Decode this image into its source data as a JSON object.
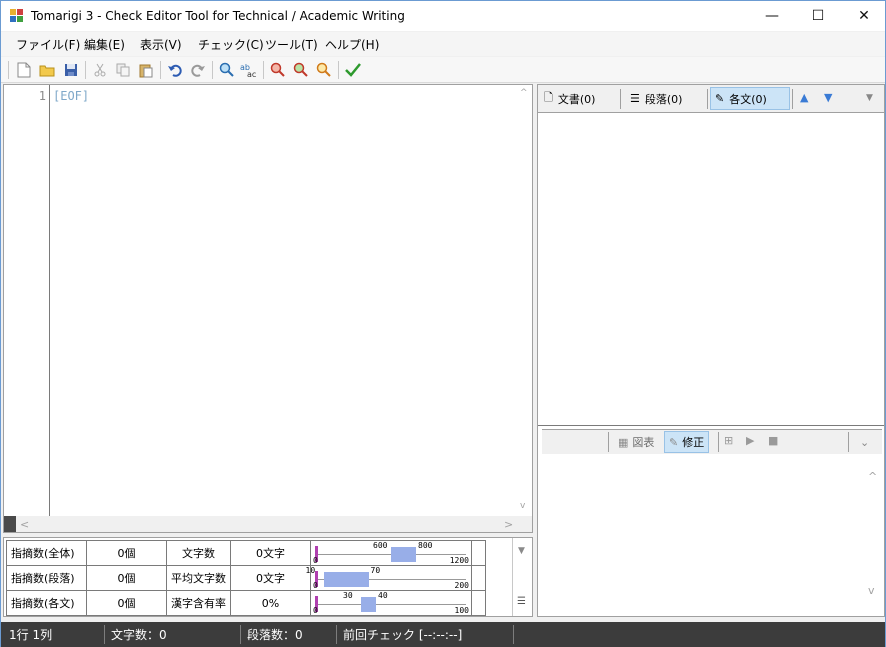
{
  "window": {
    "title": "Tomarigi 3 - Check Editor Tool for Technical / Academic Writing",
    "minimize": "—",
    "maximize": "☐",
    "close": "✕"
  },
  "menu": {
    "file": "ファイル(F)",
    "edit": "編集(E)",
    "view": "表示(V)",
    "check": "チェック(C)",
    "tools": "ツール(T)",
    "help": "ヘルプ(H)"
  },
  "toolbar_icons": [
    "new-file-icon",
    "open-folder-icon",
    "save-icon",
    "cut-icon",
    "copy-icon",
    "paste-icon",
    "undo-icon",
    "redo-icon",
    "find-icon",
    "replace-icon",
    "prev-issue-icon",
    "next-issue-icon",
    "search-zoom-icon",
    "check-icon"
  ],
  "editor": {
    "line_number": "1",
    "eof_marker": "[EOF]"
  },
  "stats": {
    "rows": [
      {
        "label": "指摘数(全体)",
        "count": "0個",
        "metric": "文字数",
        "value": "0文字"
      },
      {
        "label": "指摘数(段落)",
        "count": "0個",
        "metric": "平均文字数",
        "value": "0文字"
      },
      {
        "label": "指摘数(各文)",
        "count": "0個",
        "metric": "漢字含有率",
        "value": "0%"
      }
    ],
    "gauges": [
      {
        "min": 0,
        "max": 1200,
        "range_low": 600,
        "range_high": 800,
        "current": 0,
        "low_label": "600",
        "high_label": "800",
        "min_label": "0",
        "max_label": "1200"
      },
      {
        "min": 0,
        "max": 200,
        "range_low": 10,
        "range_high": 70,
        "current": 0,
        "low_label": "10",
        "high_label": "70",
        "min_label": "0",
        "max_label": "200"
      },
      {
        "min": 0,
        "max": 100,
        "range_low": 30,
        "range_high": 40,
        "current": 0,
        "low_label": "30",
        "high_label": "40",
        "min_label": "0",
        "max_label": "100"
      }
    ]
  },
  "right_panel": {
    "tabs": {
      "document": "文書(0)",
      "paragraph": "段落(0)",
      "sentence": "各文(0)"
    },
    "bottom_tabs": {
      "chart": "図表",
      "fix": "修正"
    }
  },
  "status": {
    "position": "1行 1列",
    "char_count": "文字数：0",
    "para_count": "段落数：0",
    "last_check": "前回チェック [--:--:--]"
  },
  "colors": {
    "accent": "#cce4f7",
    "gauge_range": "#98aee8",
    "gauge_marker": "#b040b0",
    "statusbar": "#3c3c3c"
  }
}
